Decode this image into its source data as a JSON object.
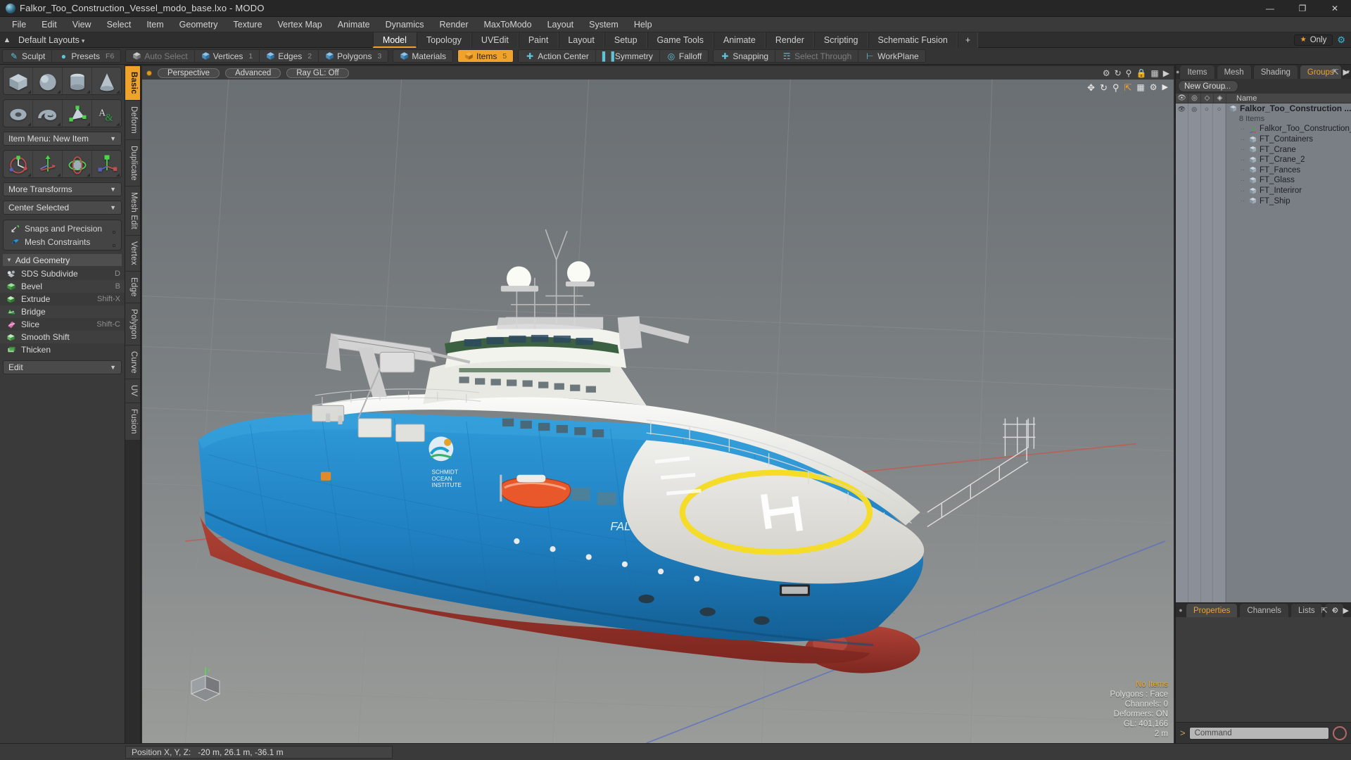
{
  "window": {
    "title": "Falkor_Too_Construction_Vessel_modo_base.lxo - MODO",
    "app_icon": "modo-sphere-icon",
    "minimize": "—",
    "maximize": "❐",
    "close": "✕"
  },
  "menubar": {
    "items": [
      "File",
      "Edit",
      "View",
      "Select",
      "Item",
      "Geometry",
      "Texture",
      "Vertex Map",
      "Animate",
      "Dynamics",
      "Render",
      "MaxToModo",
      "Layout",
      "System",
      "Help"
    ]
  },
  "layoutbar": {
    "home_icon": "home-arrow-icon",
    "default_layouts": "Default Layouts",
    "caret": "▾",
    "tabs": [
      {
        "label": "Model",
        "active": true
      },
      {
        "label": "Topology",
        "active": false
      },
      {
        "label": "UVEdit",
        "active": false
      },
      {
        "label": "Paint",
        "active": false
      },
      {
        "label": "Layout",
        "active": false
      },
      {
        "label": "Setup",
        "active": false
      },
      {
        "label": "Game Tools",
        "active": false
      },
      {
        "label": "Animate",
        "active": false
      },
      {
        "label": "Render",
        "active": false
      },
      {
        "label": "Scripting",
        "active": false
      },
      {
        "label": "Schematic Fusion",
        "active": false
      },
      {
        "label": "+",
        "active": false
      }
    ],
    "only_button": "Only",
    "star_icon": "star-icon",
    "gear_icon": "gear-icon"
  },
  "modebar": {
    "group_sculpt": [
      {
        "label": "Sculpt",
        "icon": "pen-icon",
        "key": "",
        "state": "normal"
      },
      {
        "label": "Presets",
        "icon": "sphere-icon",
        "key": "F6",
        "state": "normal"
      }
    ],
    "group_select": [
      {
        "label": "Auto Select",
        "icon": "cube-grey-icon",
        "key": "",
        "state": "dim"
      },
      {
        "label": "Vertices",
        "icon": "cube-blue-icon",
        "key": "1",
        "state": "normal"
      },
      {
        "label": "Edges",
        "icon": "cube-blue-icon",
        "key": "2",
        "state": "normal"
      },
      {
        "label": "Polygons",
        "icon": "cube-blue-icon",
        "key": "3",
        "state": "normal"
      }
    ],
    "group_mat": [
      {
        "label": "Materials",
        "icon": "cube-blue-icon",
        "key": "",
        "state": "normal"
      }
    ],
    "group_items": [
      {
        "label": "Items",
        "icon": "cube-orange-icon",
        "key": "5",
        "state": "selected"
      }
    ],
    "group_center": [
      {
        "label": "Action Center",
        "icon": "action-center-icon",
        "key": "",
        "state": "normal"
      },
      {
        "label": "Symmetry",
        "icon": "symmetry-icon",
        "key": "",
        "state": "normal"
      },
      {
        "label": "Falloff",
        "icon": "falloff-icon",
        "key": "",
        "state": "normal"
      }
    ],
    "group_snap": [
      {
        "label": "Snapping",
        "icon": "snapping-icon",
        "key": "",
        "state": "normal"
      },
      {
        "label": "Select Through",
        "icon": "select-through-icon",
        "key": "",
        "state": "dim"
      },
      {
        "label": "WorkPlane",
        "icon": "workplane-icon",
        "key": "",
        "state": "normal"
      }
    ]
  },
  "left_toolbox": {
    "primitives_row1": [
      {
        "name": "cube-primitive",
        "label": "Cube"
      },
      {
        "name": "sphere-primitive",
        "label": "Sphere"
      },
      {
        "name": "cylinder-primitive",
        "label": "Cylinder"
      },
      {
        "name": "cone-primitive",
        "label": "Cone"
      }
    ],
    "primitives_row2": [
      {
        "name": "torus-primitive",
        "label": "Torus"
      },
      {
        "name": "spiral-primitive",
        "label": "Spiral"
      },
      {
        "name": "polygon-primitive",
        "label": "Polygon"
      },
      {
        "name": "text-primitive",
        "label": "Text"
      }
    ],
    "item_menu": "Item Menu: New Item",
    "transforms": [
      {
        "name": "transform-tool",
        "label": "Transform"
      },
      {
        "name": "move-tool",
        "label": "Move"
      },
      {
        "name": "rotate-tool",
        "label": "Rotate"
      },
      {
        "name": "scale-tool",
        "label": "Scale"
      }
    ],
    "more_transforms": "More Transforms",
    "center_selected": "Center Selected",
    "snaps_and_precision": "Snaps and Precision",
    "mesh_constraints": "Mesh Constraints",
    "add_geometry_header": "Add Geometry",
    "geometry_tools": [
      {
        "label": "SDS Subdivide",
        "shortcut": "D",
        "icon": "sds-icon"
      },
      {
        "label": "Bevel",
        "shortcut": "B",
        "icon": "bevel-icon"
      },
      {
        "label": "Extrude",
        "shortcut": "Shift-X",
        "icon": "extrude-icon"
      },
      {
        "label": "Bridge",
        "shortcut": "",
        "icon": "bridge-icon"
      },
      {
        "label": "Slice",
        "shortcut": "Shift-C",
        "icon": "slice-icon"
      },
      {
        "label": "Smooth Shift",
        "shortcut": "",
        "icon": "smooth-shift-icon"
      },
      {
        "label": "Thicken",
        "shortcut": "",
        "icon": "thicken-icon"
      }
    ],
    "edit_dropdown": "Edit"
  },
  "vertical_tabs": [
    {
      "label": "Basic",
      "active": true
    },
    {
      "label": "Deform",
      "active": false
    },
    {
      "label": "Duplicate",
      "active": false
    },
    {
      "label": "Mesh Edit",
      "active": false
    },
    {
      "label": "Vertex",
      "active": false
    },
    {
      "label": "Edge",
      "active": false
    },
    {
      "label": "Polygon",
      "active": false
    },
    {
      "label": "Curve",
      "active": false
    },
    {
      "label": "UV",
      "active": false
    },
    {
      "label": "Fusion",
      "active": false
    }
  ],
  "viewport": {
    "indicator_icon": "active-viewport-dot",
    "view_mode": "Perspective",
    "shading": "Advanced",
    "raygl": "Ray GL: Off",
    "nav_icons": [
      "pan-icon",
      "rotate-icon",
      "zoom-icon",
      "fit-icon",
      "more-icon",
      "grid-icon",
      "lock-icon",
      "options-icon",
      "collapse-icon"
    ],
    "stats": {
      "selection": "No Items",
      "polygons": "Polygons : Face",
      "channels": "Channels: 0",
      "deformers": "Deformers: ON",
      "gl": "GL: 401,166",
      "grid": "2 m"
    },
    "scene_description": "3D render of the research vessel Falkor (too) — blue hull, red below waterline, white superstructure, yellow helipad circle with H marking, orange lifeboat, cranes and antennas"
  },
  "right_panel": {
    "tabs": [
      {
        "label": "Items",
        "active": false
      },
      {
        "label": "Mesh ...",
        "active": false
      },
      {
        "label": "Shading",
        "active": false
      },
      {
        "label": "Groups",
        "active": true
      }
    ],
    "tab_caret": "▾",
    "expand_icon": "expand-icon",
    "more_icon": "chevron-right-icon",
    "new_group_button": "New Group",
    "tree_columns": [
      {
        "name": "visibility-column",
        "icon": "eye-icon"
      },
      {
        "name": "render-column",
        "icon": "camera-icon"
      },
      {
        "name": "wireframe-column",
        "icon": "cube-outline-icon"
      },
      {
        "name": "shading-column",
        "icon": "cube-shaded-icon"
      }
    ],
    "tree_name_header": "Name",
    "tree": [
      {
        "label": "Falkor_Too_Construction ...",
        "icon": "group-cube-icon",
        "level": 0,
        "bold": true
      },
      {
        "label": "8 Items",
        "icon": "",
        "level": 1,
        "sub": true
      },
      {
        "label": "Falkor_Too_Construction_Ve...",
        "icon": "locator-axis-icon",
        "level": 1
      },
      {
        "label": "FT_Containers",
        "icon": "mesh-cube-icon",
        "level": 1
      },
      {
        "label": "FT_Crane",
        "icon": "mesh-cube-icon",
        "level": 1
      },
      {
        "label": "FT_Crane_2",
        "icon": "mesh-cube-icon",
        "level": 1
      },
      {
        "label": "FT_Fances",
        "icon": "mesh-cube-icon",
        "level": 1
      },
      {
        "label": "FT_Glass",
        "icon": "mesh-cube-icon",
        "level": 1
      },
      {
        "label": "FT_Interiror",
        "icon": "mesh-cube-icon",
        "level": 1
      },
      {
        "label": "FT_Ship",
        "icon": "mesh-cube-icon",
        "level": 1
      }
    ]
  },
  "properties_panel": {
    "tabs": [
      {
        "label": "Properties",
        "active": true
      },
      {
        "label": "Channels",
        "active": false
      },
      {
        "label": "Lists",
        "active": false
      },
      {
        "label": "+",
        "active": false
      }
    ],
    "expand_icon": "expand-icon",
    "gear_icon": "gear-icon",
    "more_icon": "chevron-right-icon"
  },
  "command_bar": {
    "prompt": ">",
    "placeholder": "Command",
    "record_icon": "record-icon"
  },
  "statusbar": {
    "position_label": "Position X, Y, Z:",
    "position_value": "-20 m, 26.1 m, -36.1 m"
  },
  "colors": {
    "accent": "#f0a32a",
    "panel": "#3a3a3a",
    "tree_bg": "#7a7f86",
    "hull_blue": "#1f7fc0",
    "hull_red": "#9c3329",
    "helipad_yellow": "#f5dc28",
    "lifeboat_orange": "#e8582a"
  }
}
